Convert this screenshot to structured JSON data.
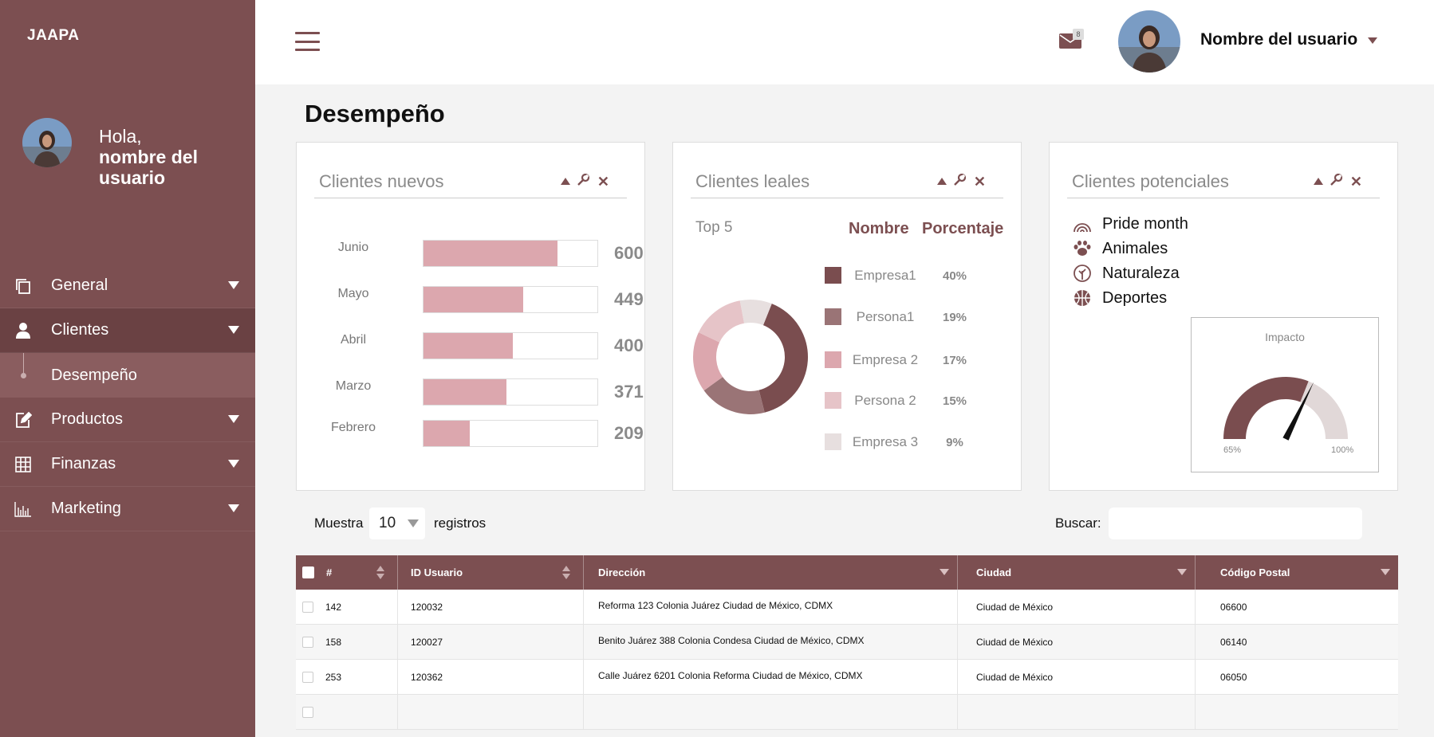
{
  "brand": "JAAPA",
  "greeting": {
    "line1": "Hola,",
    "line2": "nombre del usuario"
  },
  "nav": [
    {
      "label": "General",
      "icon": "copy-icon"
    },
    {
      "label": "Clientes",
      "icon": "user-icon",
      "active": true
    },
    {
      "label": "Productos",
      "icon": "edit-icon"
    },
    {
      "label": "Finanzas",
      "icon": "grid-icon"
    },
    {
      "label": "Marketing",
      "icon": "bar-chart-icon"
    }
  ],
  "nav_sub": {
    "label": "Desempeño"
  },
  "topbar": {
    "user_name": "Nombre del usuario",
    "mail_count": "8"
  },
  "page_title": "Desempeño",
  "cards": {
    "nuevos": {
      "title": "Clientes nuevos"
    },
    "leales": {
      "title": "Clientes leales",
      "top": "Top 5",
      "col_name": "Nombre",
      "col_pct": "Porcentaje"
    },
    "potenciales": {
      "title": "Clientes potenciales",
      "gauge_title": "Impacto",
      "gauge_min": "65%",
      "gauge_max": "100%"
    }
  },
  "chart_data": [
    {
      "type": "bar",
      "orientation": "horizontal",
      "categories": [
        "Junio",
        "Mayo",
        "Abril",
        "Marzo",
        "Febrero"
      ],
      "values": [
        600,
        449,
        400,
        371,
        209
      ],
      "xlim": [
        0,
        780
      ],
      "color": "#dca7ae"
    },
    {
      "type": "pie",
      "donut": true,
      "title": "Top 5",
      "labels": [
        "Empresa1",
        "Persona1",
        "Empresa 2",
        "Persona 2",
        "Empresa 3"
      ],
      "values": [
        40,
        19,
        17,
        15,
        9
      ],
      "value_labels": [
        "40%",
        "19%",
        "17%",
        "15%",
        "9%"
      ],
      "colors": [
        "#7a4d4f",
        "#9a7476",
        "#dca7ae",
        "#e6c4c8",
        "#e7dfdf"
      ]
    },
    {
      "type": "gauge",
      "title": "Impacto",
      "min_label": "65%",
      "max_label": "100%",
      "value_fraction": 0.62,
      "colors": [
        "#7a4d4f",
        "#e1d8d8"
      ]
    }
  ],
  "potenciales": [
    {
      "label": "Pride month",
      "icon": "rainbow-icon"
    },
    {
      "label": "Animales",
      "icon": "paw-icon"
    },
    {
      "label": "Naturaleza",
      "icon": "tree-icon"
    },
    {
      "label": "Deportes",
      "icon": "basketball-icon"
    }
  ],
  "table_controls": {
    "show": "Muestra",
    "page_size": "10",
    "records": "registros",
    "search": "Buscar:"
  },
  "table": {
    "headers": [
      "#",
      "ID Usuario",
      "Dirección",
      "Ciudad",
      "Código Postal"
    ],
    "rows": [
      [
        "142",
        "120032",
        "Reforma 123 Colonia Juárez Ciudad de México, CDMX",
        "Ciudad de México",
        "06600"
      ],
      [
        "158",
        "120027",
        "Benito Juárez 388 Colonia Condesa Ciudad de México, CDMX",
        "Ciudad de México",
        "06140"
      ],
      [
        "253",
        "120362",
        "Calle Juárez 6201 Colonia Reforma Ciudad de México, CDMX",
        "Ciudad de México",
        "06050"
      ],
      [
        "",
        "",
        "",
        "",
        ""
      ]
    ]
  },
  "colors": {
    "brand": "#7c4f51",
    "bar": "#dca7ae",
    "page_bg": "#f3f3f3"
  }
}
